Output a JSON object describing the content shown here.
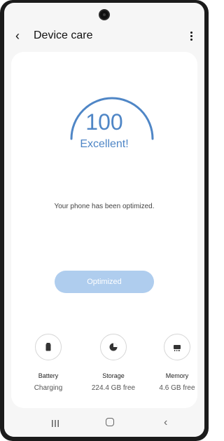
{
  "header": {
    "title": "Device care"
  },
  "score": {
    "value": "100",
    "label": "Excellent!"
  },
  "status": {
    "message": "Your phone has been optimized."
  },
  "action": {
    "button_label": "Optimized"
  },
  "stats": [
    {
      "label": "Battery",
      "value": "Charging",
      "icon": "battery-icon"
    },
    {
      "label": "Storage",
      "value": "224.4 GB free",
      "icon": "storage-icon"
    },
    {
      "label": "Memory",
      "value": "4.6 GB free",
      "icon": "memory-icon"
    }
  ],
  "colors": {
    "accent": "#4f86c6",
    "button_bg": "#afcdee",
    "screen_bg": "#f6f6f6",
    "card_bg": "#ffffff"
  }
}
